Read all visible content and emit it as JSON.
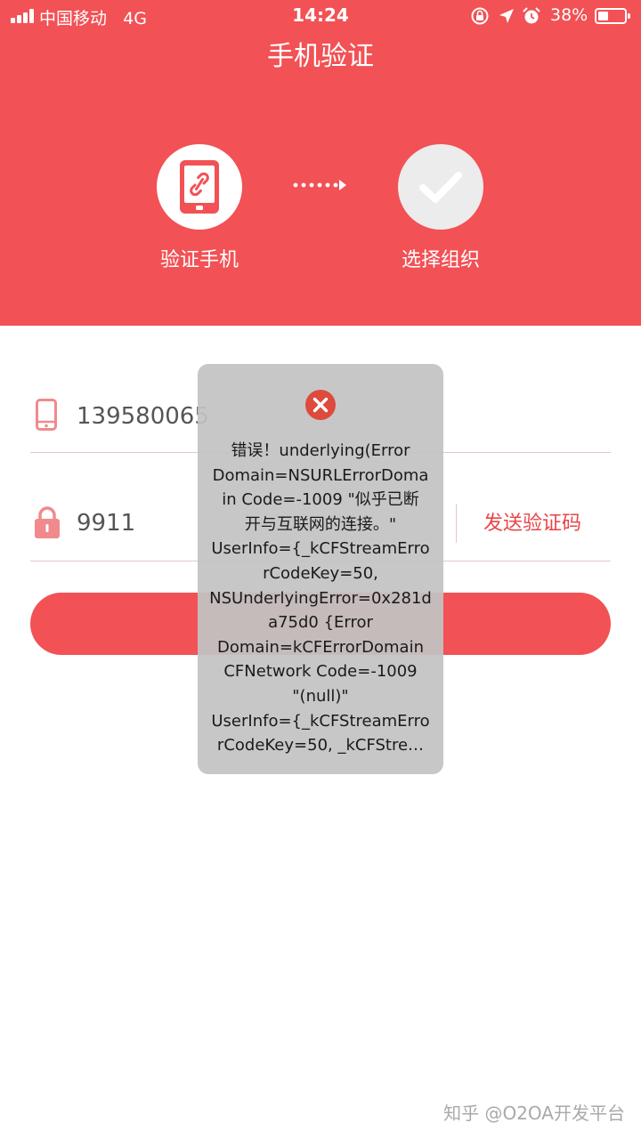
{
  "status_bar": {
    "carrier": "中国移动",
    "network": "4G",
    "time": "14:24",
    "battery_percent": "38%",
    "battery_level": 0.38,
    "icons": [
      "signal-icon",
      "orientation-lock-icon",
      "location-icon",
      "alarm-icon",
      "battery-icon"
    ]
  },
  "header": {
    "title": "手机验证",
    "background_color": "#f25155",
    "steps": [
      {
        "label": "验证手机",
        "icon": "phone-link-icon"
      },
      {
        "label": "选择组织",
        "icon": "checkmark-icon"
      }
    ]
  },
  "form": {
    "phone_value": "139580065",
    "code_value": "9911",
    "send_code_label": "发送验证码",
    "accent_color": "#e84549"
  },
  "toast": {
    "icon": "error-icon",
    "lines": [
      "错误！underlying(Error",
      "Domain=NSURLErrorDoma",
      "in Code=-1009 \"似乎已断",
      "开与互联网的连接。\"",
      "UserInfo={_kCFStreamErro",
      "rCodeKey=50,",
      "NSUnderlyingError=0x281d",
      "a75d0 {Error",
      "Domain=kCFErrorDomain",
      "CFNetwork Code=-1009",
      "\"(null)\"",
      "UserInfo={_kCFStreamErro",
      "rCodeKey=50, _kCFStre…"
    ]
  },
  "watermark": "知乎 @O2OA开发平台"
}
